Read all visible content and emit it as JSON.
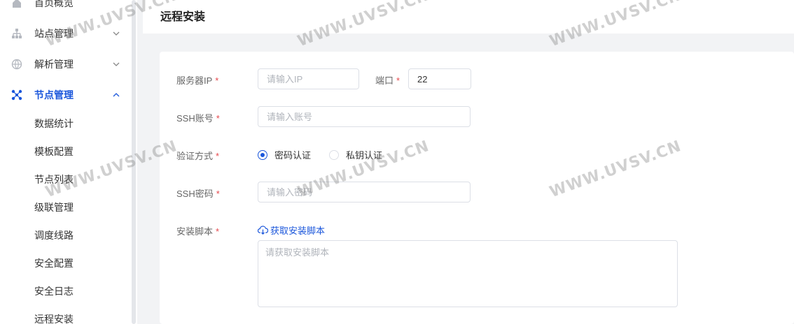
{
  "sidebar": {
    "menus": [
      {
        "label": "首页概览",
        "icon": "home-icon"
      },
      {
        "label": "站点管理",
        "icon": "sitemap-icon"
      },
      {
        "label": "解析管理",
        "icon": "globe-icon"
      },
      {
        "label": "节点管理",
        "icon": "nodes-icon"
      }
    ],
    "sub_items": [
      "数据统计",
      "模板配置",
      "节点列表",
      "级联管理",
      "调度线路",
      "安全配置",
      "安全日志",
      "远程安装"
    ]
  },
  "header": {
    "title": "远程安装"
  },
  "form": {
    "server_ip": {
      "label": "服务器IP",
      "required": "*",
      "placeholder": "请输入IP"
    },
    "port": {
      "label": "端口",
      "required": "*",
      "value": "22"
    },
    "ssh_account": {
      "label": "SSH账号",
      "required": "*",
      "placeholder": "请输入账号"
    },
    "auth_method": {
      "label": "验证方式",
      "required": "*",
      "options": [
        "密码认证",
        "私钥认证"
      ],
      "selected": "密码认证"
    },
    "ssh_password": {
      "label": "SSH密码",
      "required": "*",
      "placeholder": "请输入密码"
    },
    "install_script": {
      "label": "安装脚本",
      "required": "*",
      "link": "获取安装脚本",
      "placeholder": "请获取安装脚本"
    }
  },
  "watermark": "WWW.UVSV.CN",
  "colors": {
    "accent": "#1a56db",
    "required": "#e5484d"
  }
}
